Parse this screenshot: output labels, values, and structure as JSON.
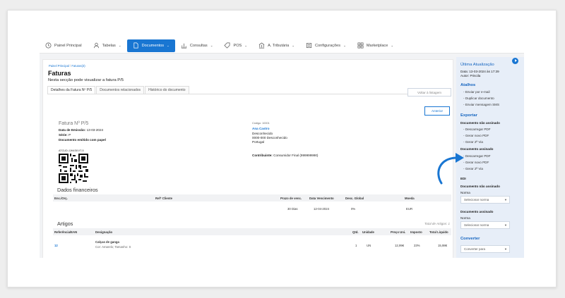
{
  "nav": {
    "items": [
      {
        "label": "Painel Principal",
        "icon": "clock-icon",
        "caret": false
      },
      {
        "label": "Tabelas",
        "icon": "user-icon",
        "caret": true
      },
      {
        "label": "Documentos",
        "icon": "document-icon",
        "caret": true,
        "active": true
      },
      {
        "label": "Consultas",
        "icon": "chart-icon",
        "caret": true
      },
      {
        "label": "POS",
        "icon": "tag-icon",
        "caret": true
      },
      {
        "label": "A. Tributária",
        "icon": "bank-icon",
        "caret": true
      },
      {
        "label": "Configurações",
        "icon": "settings-icon",
        "caret": true
      },
      {
        "label": "Marketplace",
        "icon": "grid-icon",
        "caret": true
      }
    ],
    "caret": "⌄"
  },
  "breadcrumb": {
    "home": "Painel Principal",
    "sep": "/",
    "current": "Faturas(3)"
  },
  "page": {
    "title": "Faturas",
    "subtitle": "Nesta secção pode visualizar a fatura P/5"
  },
  "tabs": [
    "Detalhes da Fatura Nº P/5",
    "Documentos relacionados",
    "Histórico do documento"
  ],
  "buttons": {
    "back": "Voltar à listagem",
    "previous": "Anterior"
  },
  "doc": {
    "title": "Fatura Nº P/5",
    "emission_label": "Data de Emissão:",
    "emission_value": "13-03-2024",
    "serie_label": "Série:",
    "serie_value": "P",
    "paper": "Documento emitido com papel",
    "atcud": "ATCUD:JJH4SKVT-5",
    "code_label": "Código:",
    "code_value": "10001",
    "client_name": "Ana Castro",
    "client_line1": "Desconhecido",
    "client_line2": "0000-000 Desconhecido",
    "client_line3": "Portugal",
    "contrib_label": "Contribuinte:",
    "contrib_value": "Consumidor Final (999999990)"
  },
  "financial": {
    "heading": "Dados financeiros",
    "headers": [
      "Enc./Orç.",
      "Refª Cliente",
      "Prazo de venc.",
      "Data Vencimento",
      "Desc. Global",
      "Moeda"
    ],
    "row": [
      "",
      "",
      "30 Dias",
      "12-04-2024",
      "0%",
      "EUR"
    ]
  },
  "articles": {
    "heading": "Artigos",
    "total_label": "Total de Artigos: 1",
    "headers": [
      "Referência/EAN",
      "Designação",
      "Qtd.",
      "Unidade",
      "Preço Uni.",
      "Imposto",
      "Total Líquido"
    ],
    "row": {
      "ref": "12",
      "name": "Calças de ganga",
      "attrs": "Cor: Amarelo; Tamanho: S",
      "qty": "1",
      "unit": "UN",
      "price": "12,99€",
      "tax": "23%",
      "total": "15,98€"
    }
  },
  "sidebar": {
    "last_update_title": "Última Atualização",
    "last_update_date": "Data: 13-03-2024 às 17:39",
    "last_update_author": "Autor: Priscila",
    "shortcuts_title": "Atalhos",
    "shortcuts": [
      "Enviar por e-mail",
      "Duplicar documento",
      "Enviar mensagem SMS"
    ],
    "export_title": "Exportar",
    "unsigned_label": "Documento não assinado",
    "unsigned_links": [
      "Descarregar PDF",
      "Gerar novo PDF",
      "Gerar 2ª Via"
    ],
    "signed_label": "Documento assinado",
    "signed_links": [
      "Descarregar PDF",
      "Gerar novo PDF",
      "Gerar 2ª Via"
    ],
    "edi_label": "EDI",
    "edi_unsigned_label": "Documento não assinado",
    "norma_label": "Norma",
    "select_placeholder": "Selecionar norma",
    "edi_signed_label": "Documento assinado",
    "norma_label2": "Norma",
    "select_placeholder2": "Selecionar norma",
    "convert_title": "Converter",
    "convert_select": "Converter para"
  },
  "colors": {
    "accent": "#1976d2",
    "sidebar_bg": "#e7eef8"
  }
}
